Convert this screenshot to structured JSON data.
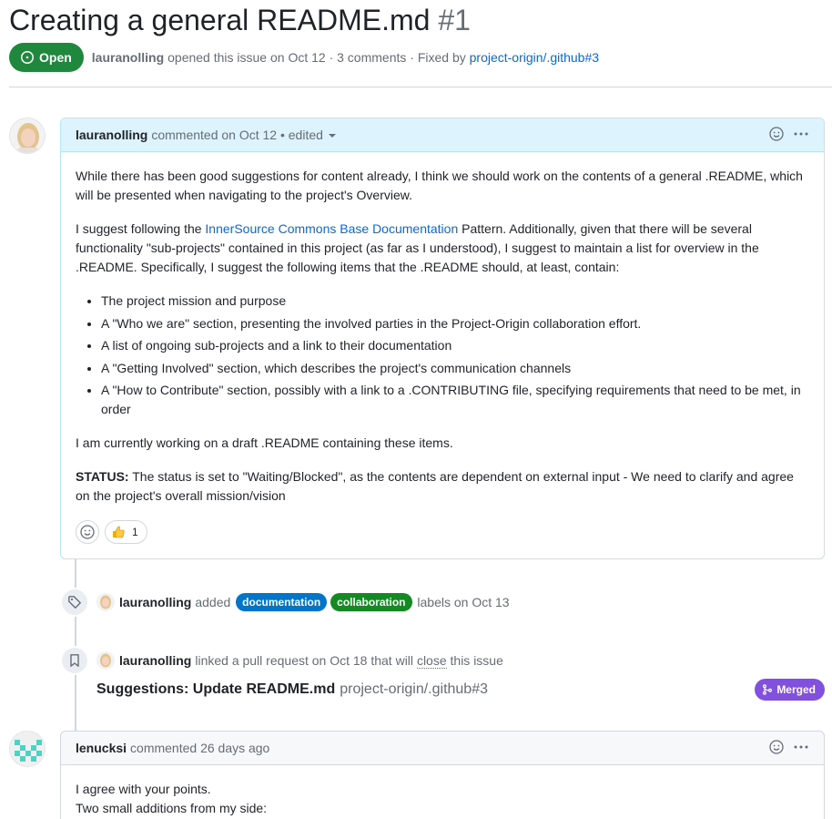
{
  "issue": {
    "title": "Creating a general README.md",
    "number": "#1",
    "state": "Open",
    "author": "lauranolling",
    "meta_text": "opened this issue on Oct 12 · 3 comments · Fixed by",
    "fixed_by": "project-origin/.github#3"
  },
  "comments": [
    {
      "author": "lauranolling",
      "meta": "commented on Oct 12 • edited",
      "p1": "While there has been good suggestions for content already, I think we should work on the contents of a general .README, which will be presented when navigating to the project's Overview.",
      "p2_pre": "I suggest following the ",
      "p2_link": "InnerSource Commons Base Documentation",
      "p2_post": " Pattern. Additionally, given that there will be several functionality \"sub-projects\" contained in this project (as far as I understood), I suggest to maintain a list for overview in the .README. Specifically, I suggest the following items that the .README should, at least, contain:",
      "items": [
        "The project mission and purpose",
        "A \"Who we are\" section, presenting the involved parties in the Project-Origin collaboration effort.",
        "A list of ongoing sub-projects and a link to their documentation",
        "A \"Getting Involved\" section, which describes the project's communication channels",
        "A \"How to Contribute\" section, possibly with a link to a .CONTRIBUTING file, specifying requirements that need to be met, in order"
      ],
      "p3": "I am currently working on a draft .README containing these items.",
      "status_label": "STATUS:",
      "status_text": " The status is set to \"Waiting/Blocked\", as the contents are dependent on external input - We need to clarify and agree on the project's overall mission/vision",
      "thumbs_count": "1"
    },
    {
      "author": "lenucksi",
      "meta": "commented 26 days ago",
      "line1": "I agree with your points.",
      "line2": "Two small additions from my side:"
    }
  ],
  "events": {
    "label_event": {
      "author": "lauranolling",
      "verb": "added",
      "labels": [
        "documentation",
        "collaboration"
      ],
      "suffix": "labels on Oct 13"
    },
    "link_event": {
      "author": "lauranolling",
      "text_pre": "linked a pull request on Oct 18 that will",
      "close_word": "close",
      "text_post": "this issue",
      "pr_title": "Suggestions: Update README.md",
      "pr_ref": "project-origin/.github#3",
      "pr_state": "Merged"
    }
  },
  "colors": {
    "open_green": "#1f883d",
    "merged_purple": "#8250df",
    "label_documentation": "#0075ca",
    "label_collaboration": "#148a22",
    "link_blue": "#0969da"
  },
  "icons": [
    "issue-open-icon",
    "smiley-icon",
    "kebab-icon",
    "thumbs-up-icon",
    "tag-icon",
    "bookmark-icon",
    "merge-icon"
  ]
}
